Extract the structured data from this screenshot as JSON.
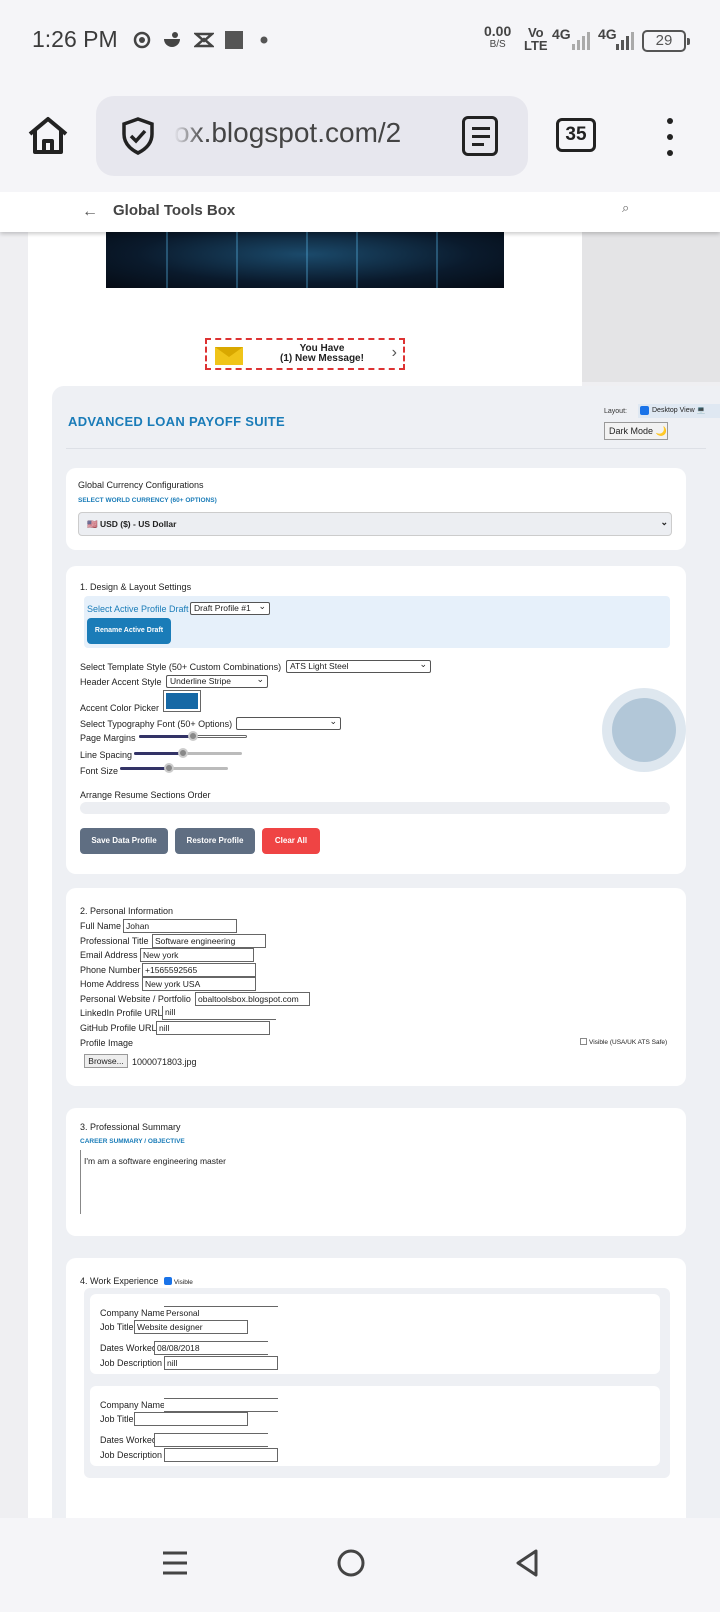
{
  "status_bar": {
    "time": "1:26 PM",
    "data_rate": "0.00",
    "data_rate_unit": "B/S",
    "volte_top": "Vo",
    "volte_bottom": "LTE",
    "network_1": "4G",
    "network_2": "4G",
    "battery": "29",
    "icons": [
      "sync-icon",
      "bowl-icon",
      "app-icon",
      "square-icon",
      "dot-icon"
    ]
  },
  "browser": {
    "url": "ox.blogspot.com/2",
    "tab_count": "35",
    "icons": [
      "home-icon",
      "shield-check-icon",
      "reader-mode-icon",
      "tabs-icon",
      "menu-icon"
    ]
  },
  "site": {
    "back": "←",
    "title": "Global Tools Box",
    "search": "⌕",
    "ad_line1": "You Have",
    "ad_line2": "(1) New Message!",
    "ad_arrow": "›"
  },
  "tool": {
    "title": "ADVANCED LOAN PAYOFF SUITE",
    "layout_label": "Layout:",
    "desktop_view": "Desktop View 💻",
    "dark_mode": "Dark Mode 🌙",
    "currency": {
      "heading": "Global Currency Configurations",
      "caption": "SELECT WORLD CURRENCY (60+ OPTIONS)",
      "selected": "🇺🇸 USD ($) - US Dollar"
    },
    "design": {
      "heading": "1. Design & Layout Settings",
      "profile_label": "Select Active Profile Draft",
      "profile_value": "Draft Profile #1",
      "rename_button": "Rename Active Draft",
      "template_label": "Select Template Style (50+ Custom Combinations)",
      "template_value": "ATS Light Steel",
      "header_label": "Header Accent Style",
      "header_value": "Underline Stripe",
      "accent_label": "Accent Color Picker",
      "accent_color": "#1668a5",
      "font_label": "Select Typography Font (50+ Options)",
      "font_value": "",
      "margins_label": "Page Margins",
      "margins_level": 0.5,
      "spacing_label": "Line Spacing",
      "spacing_level": 0.45,
      "fontsize_label": "Font Size",
      "fontsize_level": 0.45,
      "order_label": "Arrange Resume Sections Order",
      "save_button": "Save Data Profile",
      "restore_button": "Restore Profile",
      "clear_button": "Clear All"
    },
    "personal": {
      "heading": "2. Personal Information",
      "full_name_label": "Full Name",
      "full_name": "Johan",
      "title_label": "Professional Title",
      "title": "Software engineering",
      "email_label": "Email Address",
      "email": "New york",
      "phone_label": "Phone Number",
      "phone": "+1565592565",
      "address_label": "Home Address",
      "address": "New york USA",
      "website_label": "Personal Website / Portfolio",
      "website": "obaltoolsbox.blogspot.com",
      "linkedin_label": "LinkedIn Profile URL",
      "linkedin": "nill",
      "github_label": "GitHub Profile URL",
      "github": "nill",
      "image_label": "Profile Image",
      "browse_button": "Browse...",
      "file_name": "1000071803.jpg",
      "visible_label": "Visible (USA/UK ATS Safe)"
    },
    "summary": {
      "heading": "3. Professional Summary",
      "caption": "CAREER SUMMARY / OBJECTIVE",
      "text": "I'm am a software engineering master"
    },
    "work": {
      "heading": "4. Work Experience",
      "visible_label": "Visible",
      "company_label": "Company Name",
      "job_label": "Job Title",
      "dates_label": "Dates Worked",
      "desc_label": "Job Description",
      "entries": [
        {
          "company": "Personal",
          "job": "Website designer",
          "dates": "08/08/2018",
          "desc": "nill"
        },
        {
          "company": "",
          "job": "",
          "dates": "",
          "desc": ""
        }
      ]
    }
  }
}
